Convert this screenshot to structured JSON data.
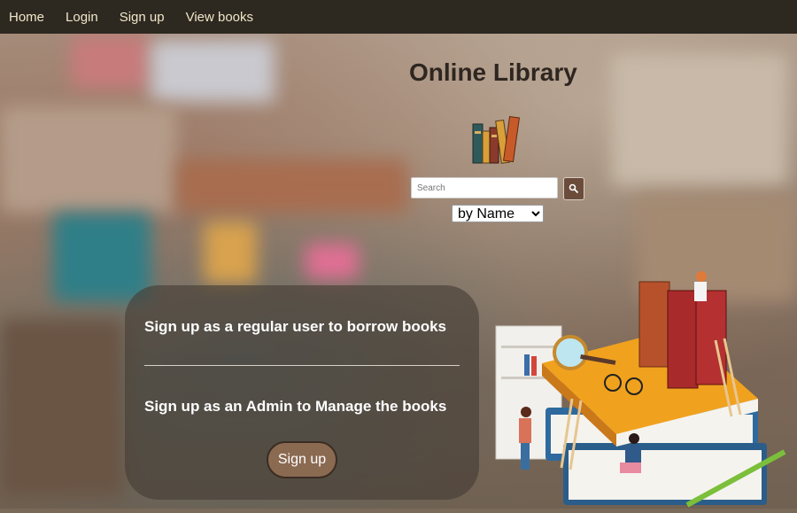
{
  "nav": {
    "items": [
      "Home",
      "Login",
      "Sign up",
      "View books"
    ]
  },
  "title": "Online Library",
  "search": {
    "placeholder": "Search",
    "button_icon": "magnifier-icon"
  },
  "filter": {
    "selected": "by Name"
  },
  "panel": {
    "regular_text": "Sign up as a regular user to borrow books",
    "admin_text": "Sign up as an Admin to Manage the books",
    "signup_label": "Sign up"
  },
  "colors": {
    "navbar": "#2d2820",
    "nav_text": "#f0e6c8",
    "button": "#8b6a52",
    "search_button": "#6b4c3b"
  }
}
